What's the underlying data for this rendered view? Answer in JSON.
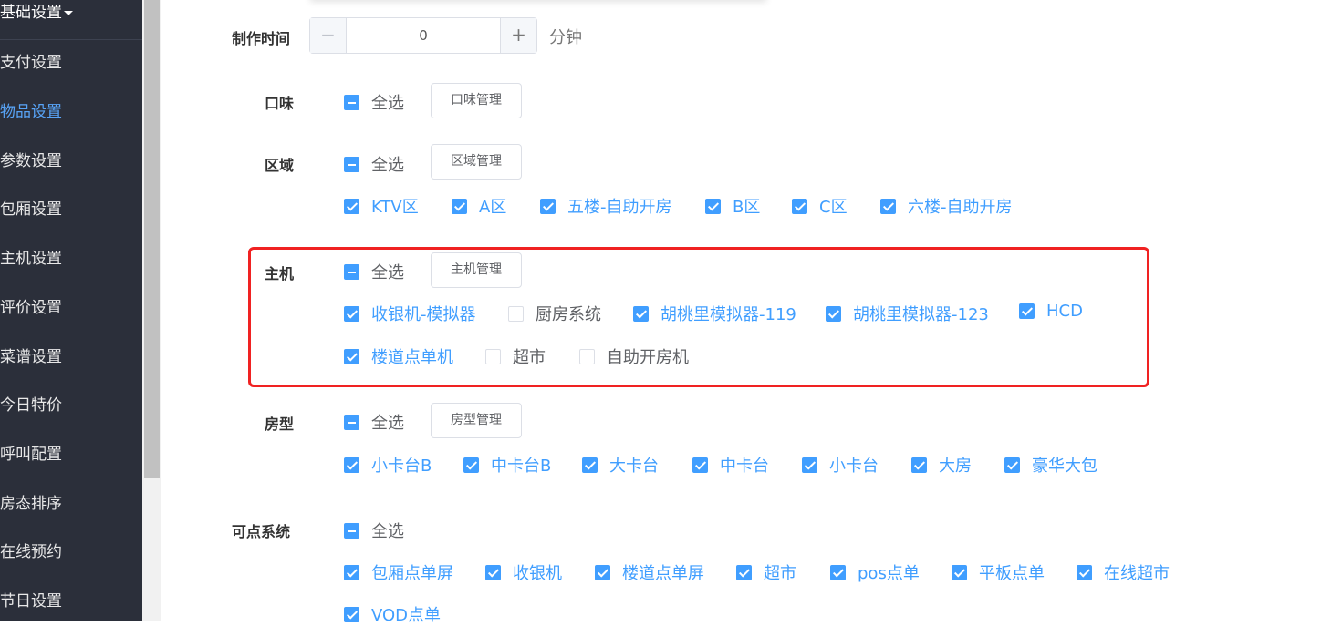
{
  "sidebar": {
    "header": "基础设置",
    "items": [
      {
        "label": "支付设置",
        "active": false
      },
      {
        "label": "物品设置",
        "active": true
      },
      {
        "label": "参数设置",
        "active": false
      },
      {
        "label": "包厢设置",
        "active": false
      },
      {
        "label": "主机设置",
        "active": false
      },
      {
        "label": "评价设置",
        "active": false
      },
      {
        "label": "菜谱设置",
        "active": false
      },
      {
        "label": "今日特价",
        "active": false
      },
      {
        "label": "呼叫配置",
        "active": false
      },
      {
        "label": "房态排序",
        "active": false
      },
      {
        "label": "在线预约",
        "active": false
      },
      {
        "label": "节日设置",
        "active": false
      }
    ]
  },
  "form": {
    "make_time": {
      "label": "制作时间",
      "value": "0",
      "unit": "分钟",
      "minus": "−",
      "plus": "+"
    },
    "flavor": {
      "label": "口味",
      "select_all": "全选",
      "manage": "口味管理"
    },
    "area": {
      "label": "区域",
      "select_all": "全选",
      "manage": "区域管理",
      "options": [
        "KTV区",
        "A区",
        "五楼-自助开房",
        "B区",
        "C区",
        "六楼-自助开房"
      ]
    },
    "host": {
      "label": "主机",
      "select_all": "全选",
      "manage": "主机管理",
      "options": [
        "收银机-模拟器",
        "厨房系统",
        "胡桃里模拟器-119",
        "胡桃里模拟器-123",
        "HCD",
        "楼道点单机",
        "超市",
        "自助开房机"
      ]
    },
    "room_type": {
      "label": "房型",
      "select_all": "全选",
      "manage": "房型管理",
      "options": [
        "小卡台B",
        "中卡台B",
        "大卡台",
        "中卡台",
        "小卡台",
        "大房",
        "豪华大包"
      ]
    },
    "system": {
      "label": "可点系统",
      "select_all": "全选",
      "options": [
        "包厢点单屏",
        "收银机",
        "楼道点单屏",
        "超市",
        "pos点单",
        "平板点单",
        "在线超市",
        "VOD点单"
      ]
    }
  }
}
